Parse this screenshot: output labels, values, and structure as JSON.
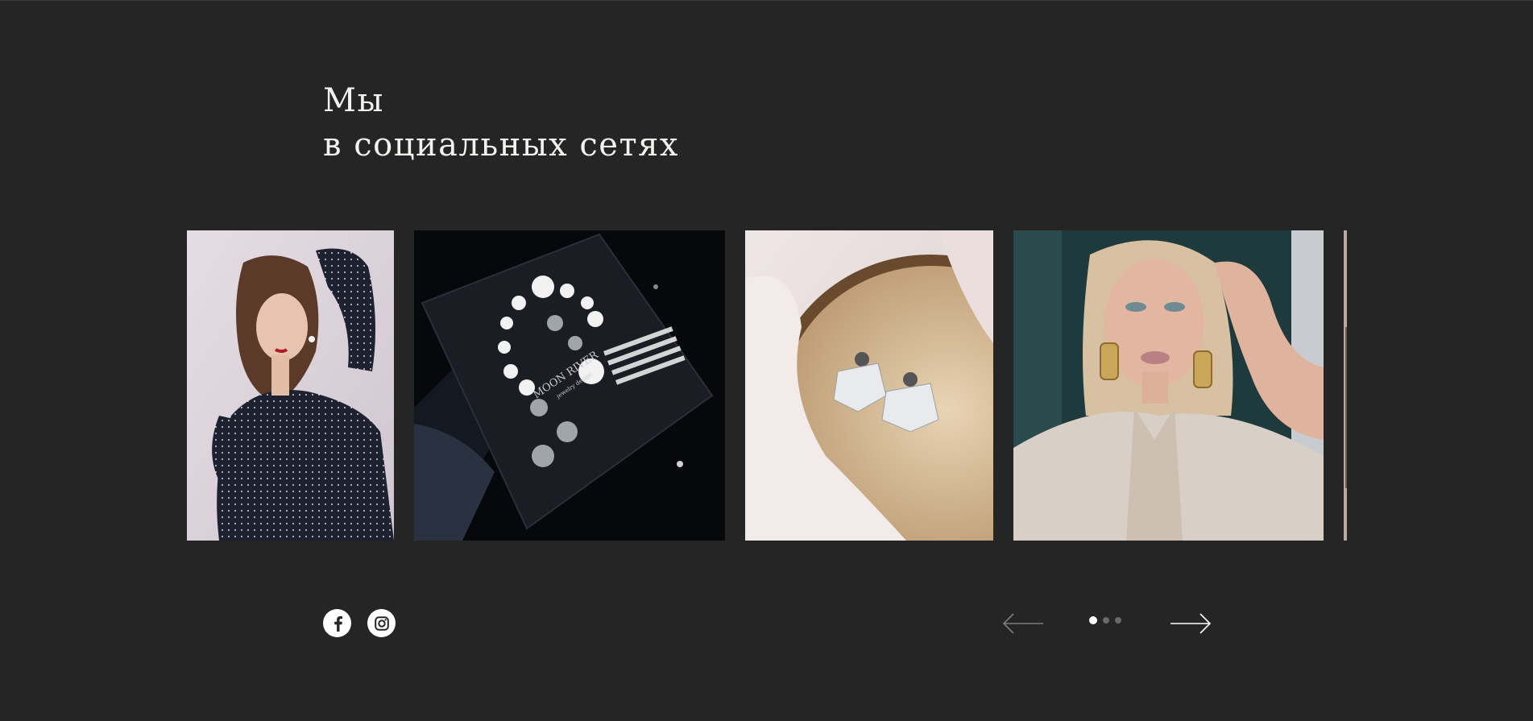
{
  "section": {
    "heading_line1": "Мы",
    "heading_line2": "в социальных сетях"
  },
  "gallery": {
    "items": [
      {
        "name": "woman-polka-dot-blouse-photo",
        "subject": "woman in dark polka-dot blouse wearing pearl earring"
      },
      {
        "name": "pearl-bracelet-photo",
        "subject": "silver and pearl bracelet on a black box",
        "box_text_1": "MOON RIVER",
        "box_text_2": "jewelry design"
      },
      {
        "name": "crystal-earrings-photo",
        "subject": "crystal tassel earrings on satin fabric"
      },
      {
        "name": "woman-gold-earrings-photo",
        "subject": "blonde woman wearing gold earrings and beige blazer"
      },
      {
        "name": "next-photo-partial",
        "subject": "partially visible next photo"
      }
    ]
  },
  "social": {
    "facebook_icon": "facebook-icon",
    "instagram_icon": "instagram-icon"
  },
  "carousel": {
    "prev_icon": "arrow-left-icon",
    "next_icon": "arrow-right-icon",
    "active_page": 1,
    "page_count": 3
  },
  "colors": {
    "background": "#252525",
    "text": "#f4f2ef",
    "dot_active": "#ffffff",
    "dot_inactive": "#6a6a6a",
    "arrow_prev": "#7d7d7d",
    "arrow_next": "#ffffff"
  }
}
